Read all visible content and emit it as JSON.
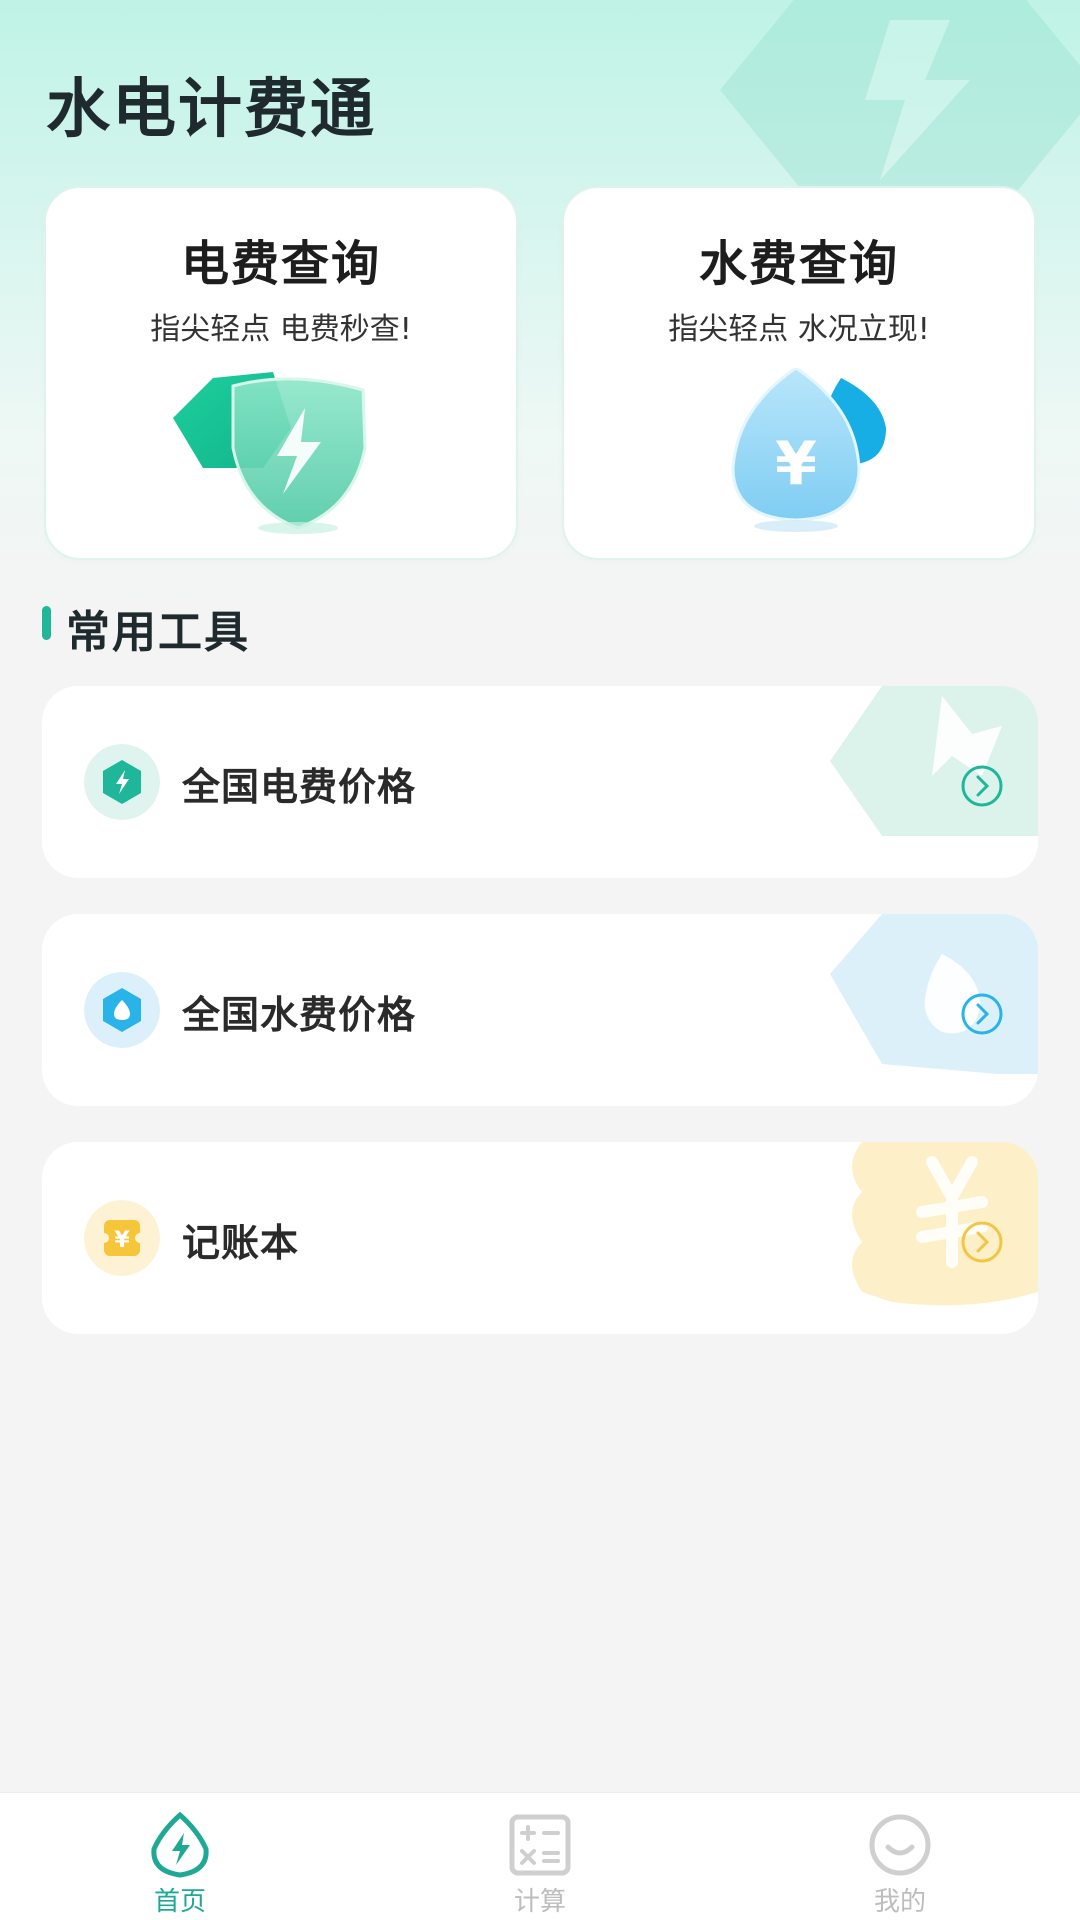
{
  "app": {
    "title": "水电计费通"
  },
  "query_cards": [
    {
      "title": "电费查询",
      "subtitle": "指尖轻点 电费秒查!",
      "icon": "lightning-shield-icon"
    },
    {
      "title": "水费查询",
      "subtitle": "指尖轻点 水况立现!",
      "icon": "water-drop-yuan-icon"
    }
  ],
  "tools": {
    "section_title": "常用工具",
    "items": [
      {
        "label": "全国电费价格",
        "icon": "electricity-hexagon-icon",
        "accent": "#1fb69a"
      },
      {
        "label": "全国水费价格",
        "icon": "water-hexagon-icon",
        "accent": "#29b3e8"
      },
      {
        "label": "记账本",
        "icon": "yuan-ticket-icon",
        "accent": "#f6c63a"
      }
    ]
  },
  "bottom_nav": {
    "items": [
      {
        "label": "首页",
        "icon": "home-lightning-icon",
        "active": true
      },
      {
        "label": "计算",
        "icon": "calculator-icon",
        "active": false
      },
      {
        "label": "我的",
        "icon": "smile-profile-icon",
        "active": false
      }
    ]
  },
  "colors": {
    "primary": "#1fa995",
    "water": "#29b3e8",
    "ledger": "#f6c63a",
    "background": "#f4f4f4"
  }
}
